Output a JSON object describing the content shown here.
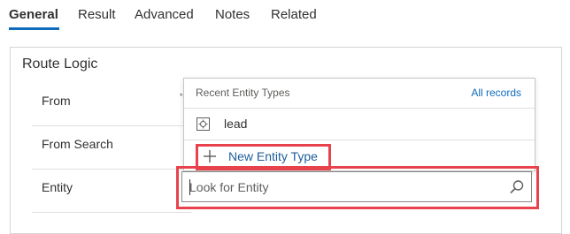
{
  "tabs": [
    {
      "label": "General",
      "active": true
    },
    {
      "label": "Result",
      "active": false
    },
    {
      "label": "Advanced",
      "active": false
    },
    {
      "label": "Notes",
      "active": false
    },
    {
      "label": "Related",
      "active": false
    }
  ],
  "card": {
    "title": "Route Logic",
    "fields": [
      {
        "label": "From"
      },
      {
        "label": "From Search"
      },
      {
        "label": "Entity"
      }
    ],
    "required_mark": "*"
  },
  "flyout": {
    "title": "Recent Entity Types",
    "all_records": "All records",
    "results": [
      {
        "label": "lead",
        "icon": "entity-icon"
      }
    ],
    "new_button": {
      "label": "New Entity Type",
      "icon": "plus-icon"
    }
  },
  "search": {
    "value": "",
    "placeholder": "Look for Entity",
    "icon": "search-icon"
  },
  "colors": {
    "accent": "#0f6cbd",
    "highlight": "#e8424d",
    "link": "#1c5d99"
  }
}
